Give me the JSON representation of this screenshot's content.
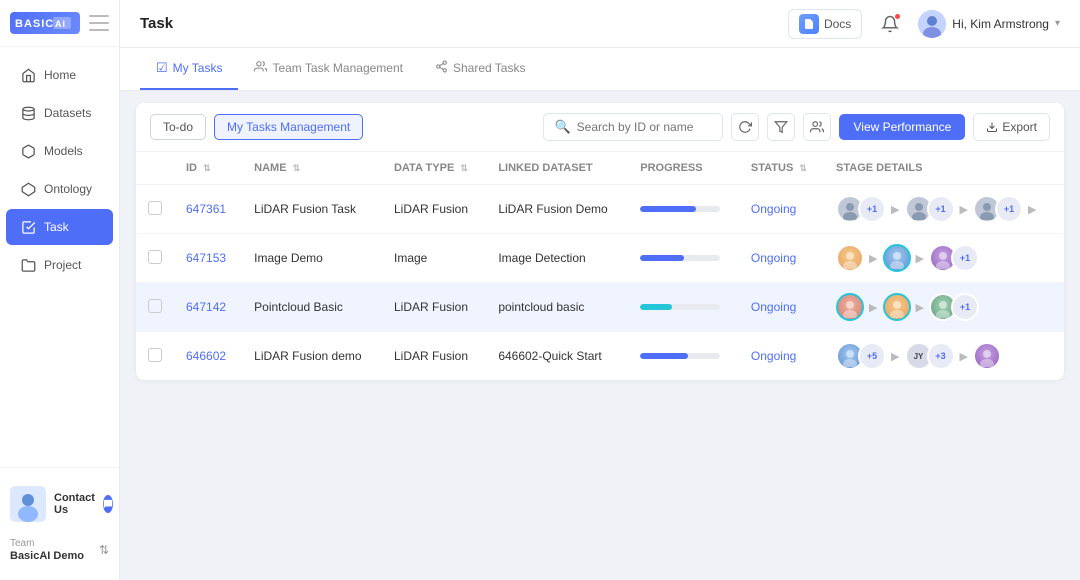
{
  "sidebar": {
    "logo_text": "BASIC AI",
    "nav_items": [
      {
        "id": "home",
        "label": "Home",
        "icon": "🏠",
        "active": false
      },
      {
        "id": "datasets",
        "label": "Datasets",
        "icon": "🗄️",
        "active": false
      },
      {
        "id": "models",
        "label": "Models",
        "icon": "🧊",
        "active": false
      },
      {
        "id": "ontology",
        "label": "Ontology",
        "icon": "🔷",
        "active": false
      },
      {
        "id": "task",
        "label": "Task",
        "icon": "✅",
        "active": true
      },
      {
        "id": "project",
        "label": "Project",
        "icon": "📁",
        "active": false
      }
    ],
    "contact_us": "Contact Us",
    "team_label": "Team",
    "team_name": "BasicAI Demo"
  },
  "header": {
    "title": "Task",
    "docs_label": "Docs",
    "user_name": "Hi, Kim Armstrong"
  },
  "tabs": [
    {
      "id": "my-tasks",
      "label": "My Tasks",
      "active": true,
      "icon": "☑"
    },
    {
      "id": "team-task",
      "label": "Team Task Management",
      "active": false,
      "icon": "👥"
    },
    {
      "id": "shared-tasks",
      "label": "Shared Tasks",
      "active": false,
      "icon": "🔗"
    }
  ],
  "toolbar": {
    "todo_label": "To-do",
    "my_tasks_label": "My Tasks Management",
    "search_placeholder": "Search by ID or name",
    "view_perf_label": "View Performance",
    "export_label": "Export"
  },
  "table": {
    "columns": [
      {
        "id": "id",
        "label": "ID",
        "sortable": true
      },
      {
        "id": "name",
        "label": "NAME",
        "sortable": true
      },
      {
        "id": "data_type",
        "label": "DATA TYPE",
        "sortable": true
      },
      {
        "id": "linked_dataset",
        "label": "LINKED DATASET",
        "sortable": false
      },
      {
        "id": "progress",
        "label": "PROGRESS",
        "sortable": false
      },
      {
        "id": "status",
        "label": "STATUS",
        "sortable": true
      },
      {
        "id": "stage_details",
        "label": "STAGE DETAILS",
        "sortable": false
      }
    ],
    "rows": [
      {
        "id": "647361",
        "name": "LiDAR Fusion Task",
        "data_type": "LiDAR Fusion",
        "linked_dataset": "LiDAR Fusion Demo",
        "progress": 70,
        "progress_color": "blue",
        "status": "Ongoing",
        "highlighted": false
      },
      {
        "id": "647153",
        "name": "Image Demo",
        "data_type": "Image",
        "linked_dataset": "Image Detection",
        "progress": 55,
        "progress_color": "blue",
        "status": "Ongoing",
        "highlighted": false
      },
      {
        "id": "647142",
        "name": "Pointcloud Basic",
        "data_type": "LiDAR Fusion",
        "linked_dataset": "pointcloud basic",
        "progress": 40,
        "progress_color": "teal",
        "status": "Ongoing",
        "highlighted": true
      },
      {
        "id": "646602",
        "name": "LiDAR Fusion demo",
        "data_type": "LiDAR Fusion",
        "linked_dataset": "646602-Quick Start",
        "progress": 60,
        "progress_color": "blue",
        "status": "Ongoing",
        "highlighted": false
      }
    ]
  }
}
